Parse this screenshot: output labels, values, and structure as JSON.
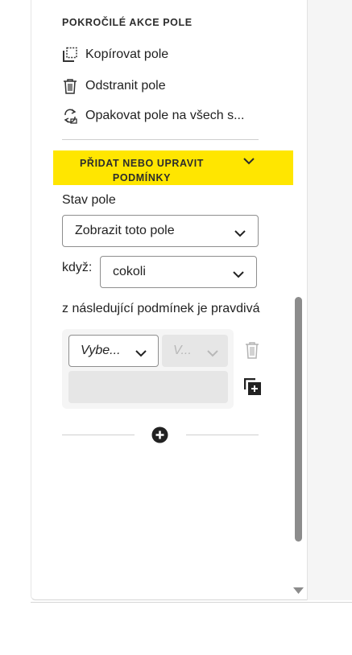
{
  "advanced": {
    "heading": "POKROČILÉ AKCE POLE",
    "copy_label": "Kopírovat pole",
    "delete_label": "Odstranit pole",
    "repeat_label": "Opakovat pole na všech s..."
  },
  "conditions": {
    "banner_title": "PŘIDAT NEBO UPRAVIT PODMÍNKY",
    "banner_color": "#ffe600",
    "state_label": "Stav pole",
    "state_value": "Zobrazit toto pole",
    "when_label": "když:",
    "when_value": "cokoli",
    "rule_text": "z následující podmínek je pravdivá",
    "field_select_value": "Vybe...",
    "operator_select_value": "V...",
    "value_input": ""
  },
  "icons": [
    "copy-field-icon",
    "trash-icon",
    "repeat-icon",
    "chevron-down-icon",
    "add-copy-icon",
    "add-circle-icon"
  ]
}
